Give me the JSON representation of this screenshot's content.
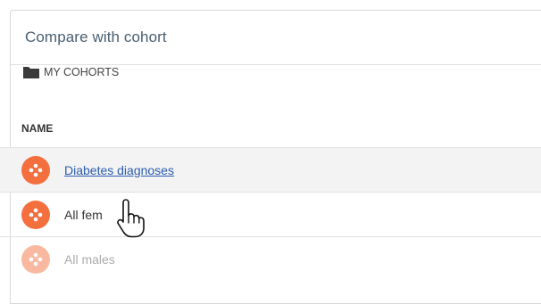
{
  "panel": {
    "title": "Compare with cohort"
  },
  "folder": {
    "icon": "folder-icon",
    "label": "MY COHORTS"
  },
  "table": {
    "column_header": "NAME",
    "rows": [
      {
        "label": "Diabetes diagnoses",
        "icon": "cohort-icon",
        "state": "hovered-link"
      },
      {
        "label": "All fem",
        "icon": "cohort-icon",
        "state": "normal"
      },
      {
        "label": "All males",
        "icon": "cohort-icon",
        "state": "faded"
      }
    ]
  },
  "cursor": {
    "icon": "hand-pointer-icon"
  },
  "colors": {
    "accent": "#f36f3e",
    "link": "#2a5db0",
    "title": "#4a5f72"
  }
}
